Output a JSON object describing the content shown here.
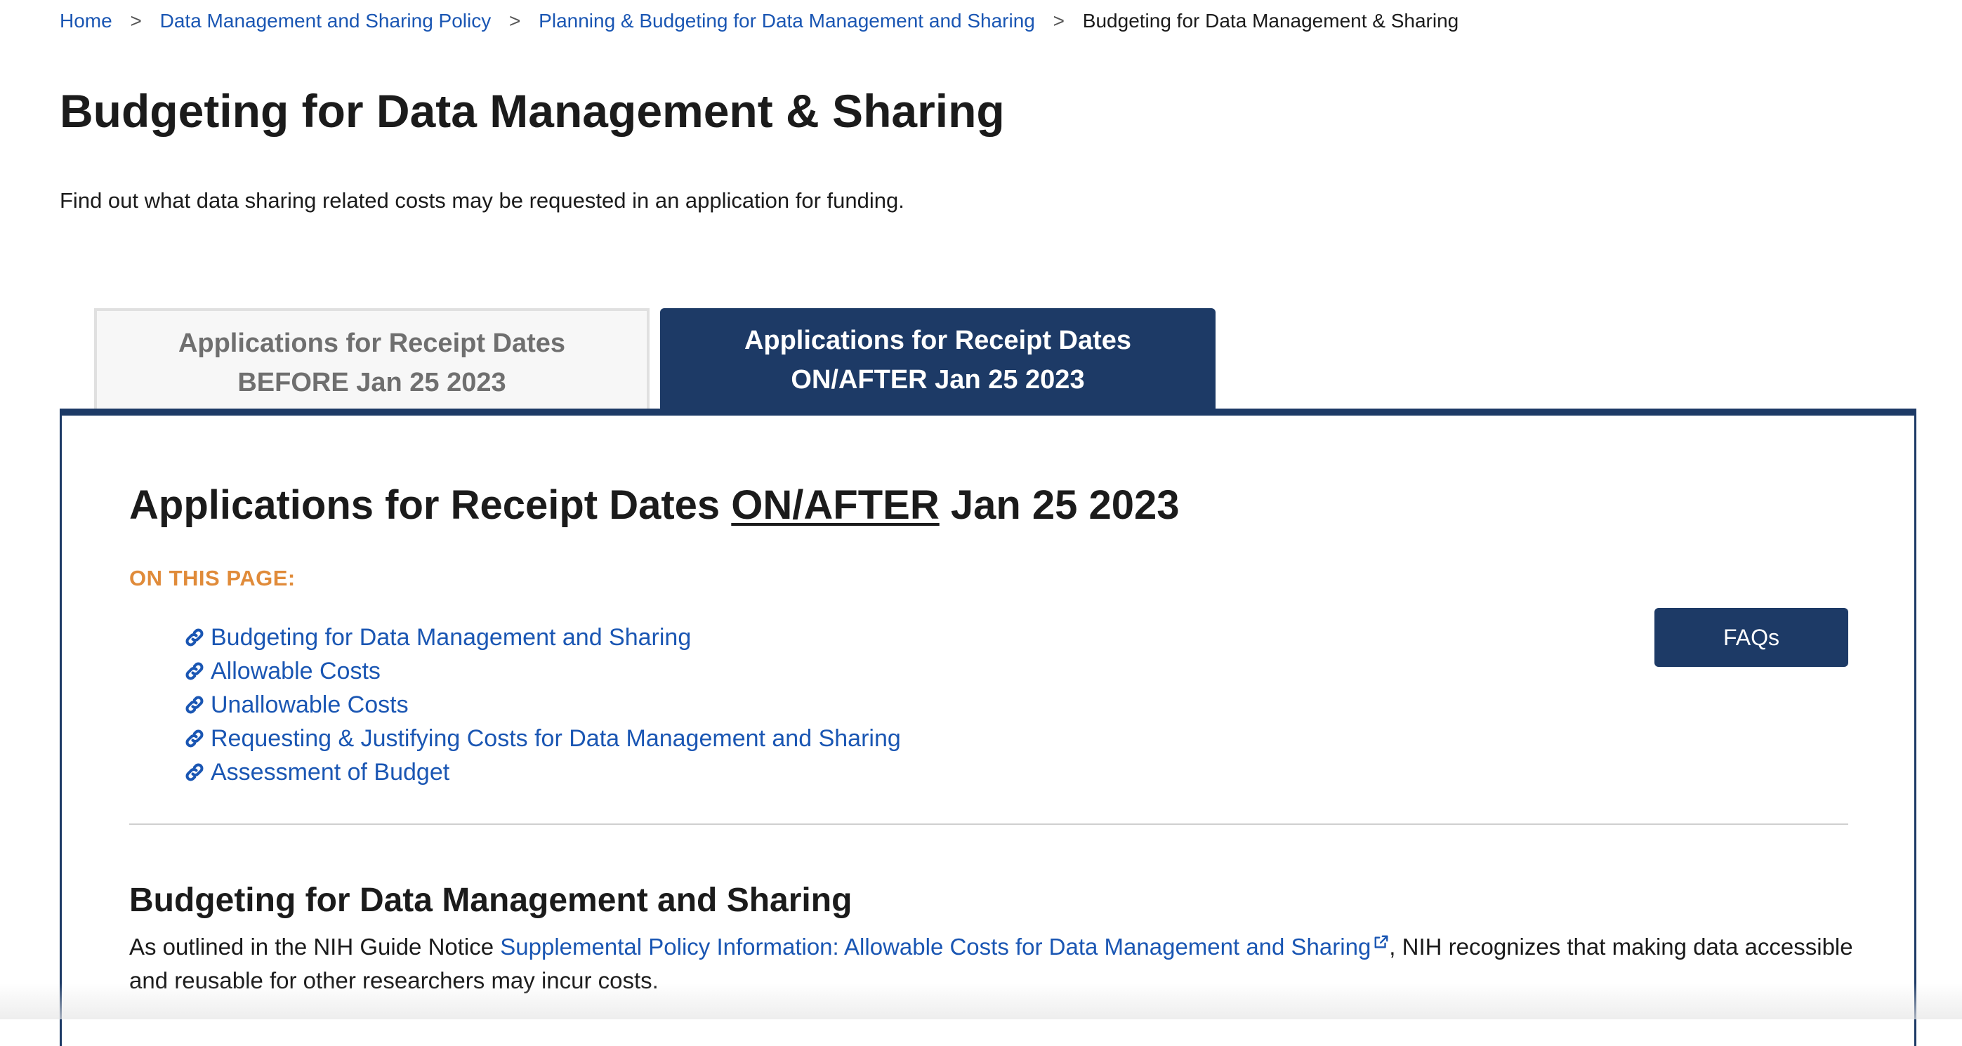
{
  "breadcrumb": {
    "items": [
      {
        "label": "Home"
      },
      {
        "label": "Data Management and Sharing Policy"
      },
      {
        "label": "Planning & Budgeting for Data Management and Sharing"
      }
    ],
    "separator": ">",
    "current": "Budgeting for Data Management & Sharing"
  },
  "page": {
    "title": "Budgeting for Data Management & Sharing",
    "intro": "Find out what data sharing related costs may be requested in an application for funding."
  },
  "tabs": [
    {
      "line1": "Applications for Receipt Dates",
      "line2": "BEFORE Jan 25 2023",
      "active": false
    },
    {
      "line1": "Applications for Receipt Dates",
      "line2": "ON/AFTER Jan 25 2023",
      "active": true
    }
  ],
  "panel": {
    "title_prefix": "Applications for Receipt Dates ",
    "title_emphasis": "ON/AFTER",
    "title_suffix": " Jan 25 2023",
    "on_this_page_label": "ON THIS PAGE:",
    "toc": [
      {
        "label": "Budgeting for Data Management and Sharing"
      },
      {
        "label": "Allowable Costs"
      },
      {
        "label": "Unallowable Costs"
      },
      {
        "label": "Requesting & Justifying Costs for Data Management and Sharing"
      },
      {
        "label": "Assessment of Budget"
      }
    ],
    "faq_button": "FAQs"
  },
  "section": {
    "title": "Budgeting for Data Management and Sharing",
    "body_prefix": "As outlined in the NIH Guide Notice ",
    "body_link": "Supplemental Policy Information: Allowable Costs for Data Management and Sharing",
    "body_suffix": ", NIH recognizes that making data accessible and reusable for other researchers may incur costs."
  },
  "colors": {
    "accent_navy": "#1d3a66",
    "link_blue": "#1a56b3",
    "orange_label": "#e08b3a"
  },
  "icons": [
    "link-icon",
    "external-link-icon"
  ]
}
